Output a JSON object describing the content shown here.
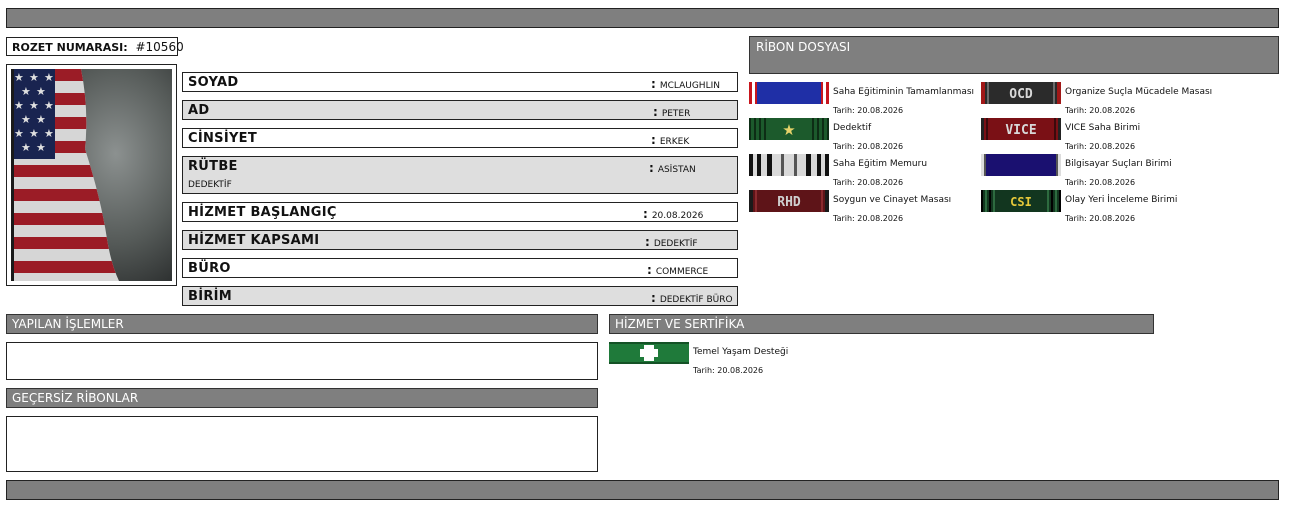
{
  "badge": {
    "label": "ROZET NUMARASI:",
    "number": "#10560"
  },
  "profile": [
    {
      "label": "SOYAD",
      "value": "MCLAUGHLIN",
      "extra": ""
    },
    {
      "label": "AD",
      "value": "PETER",
      "extra": ""
    },
    {
      "label": "CİNSİYET",
      "value": "ERKEK",
      "extra": ""
    },
    {
      "label": "RÜTBE",
      "value": "ASİSTAN",
      "extra": "DEDEKTİF"
    },
    {
      "label": "HİZMET BAŞLANGIÇ",
      "value": "20.08.2026",
      "extra": ""
    },
    {
      "label": "HİZMET KAPSAMI",
      "value": "DEDEKTİF",
      "extra": ""
    },
    {
      "label": "BÜRO",
      "value": "COMMERCE",
      "extra": ""
    },
    {
      "label": "BİRİM",
      "value": "DEDEKTİF BÜRO",
      "extra": ""
    }
  ],
  "ribbons": {
    "title": "RİBON DOSYASI",
    "items": [
      {
        "name": "Saha Eğitiminin Tamamlanması",
        "date": "Tarih: 20.08.2026",
        "icon": "blue-red-stripe-ribbon"
      },
      {
        "name": "Organize Suçla Mücadele Masası",
        "date": "Tarih: 20.08.2026",
        "icon": "ocd-ribbon",
        "text": "OCD"
      },
      {
        "name": "Dedektif",
        "date": "Tarih: 20.08.2026",
        "icon": "green-star-ribbon"
      },
      {
        "name": "VICE Saha Birimi",
        "date": "Tarih: 20.08.2026",
        "icon": "vice-ribbon",
        "text": "VICE"
      },
      {
        "name": "Saha Eğitim Memuru",
        "date": "Tarih: 20.08.2026",
        "icon": "black-white-stripe-ribbon"
      },
      {
        "name": "Bilgisayar Suçları Birimi",
        "date": "Tarih: 20.08.2026",
        "icon": "navy-ribbon"
      },
      {
        "name": "Soygun ve Cinayet Masası",
        "date": "Tarih: 20.08.2026",
        "icon": "rhd-ribbon",
        "text": "RHD"
      },
      {
        "name": "Olay Yeri İnceleme Birimi",
        "date": "Tarih: 20.08.2026",
        "icon": "csi-ribbon",
        "text": "CSI"
      }
    ]
  },
  "operations": {
    "title": "YAPILAN İŞLEMLER"
  },
  "invalid_ribbons": {
    "title": "GEÇERSİZ RİBONLAR"
  },
  "service": {
    "title": "HİZMET VE SERTİFİKA",
    "items": [
      {
        "name": "Temel Yaşam Desteği",
        "date": "Tarih: 20.08.2026",
        "icon": "green-cross-ribbon"
      }
    ]
  },
  "colors": {
    "band": "#7f7f7f",
    "row_alt": "#dedede"
  }
}
